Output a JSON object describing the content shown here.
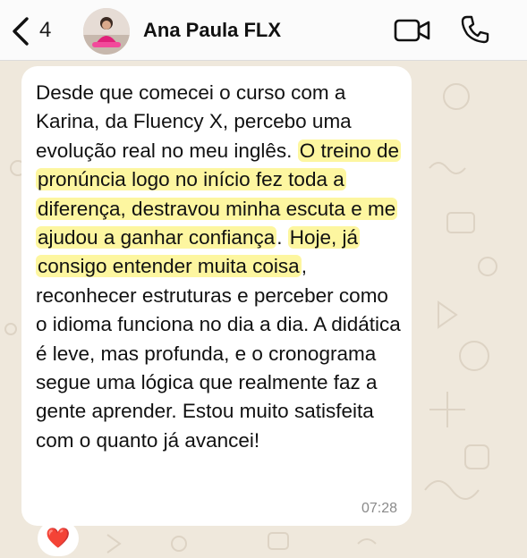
{
  "header": {
    "back_count": "4",
    "contact_name": "Ana Paula FLX"
  },
  "message": {
    "parts": {
      "p1": "Desde que comecei o curso com a Karina, da Fluency X, percebo uma evolução real no meu inglês. ",
      "h1": "O treino de pronúncia logo no início fez toda a diferença, destravou minha escuta e me ajudou a ganhar confiança",
      "p2": ". ",
      "h2": "Hoje, já consigo entender muita coisa",
      "p3": ", reconhecer estruturas e perceber como o idioma funciona no dia a dia. A didática é leve, mas profunda, e o cronograma segue uma lógica que realmente faz a gente aprender. Estou muito satisfeita com o quanto já avancei!"
    },
    "time": "07:28",
    "reaction": "❤️"
  },
  "colors": {
    "highlight": "#fdf6a0",
    "reaction_heart": "#e0182d"
  }
}
